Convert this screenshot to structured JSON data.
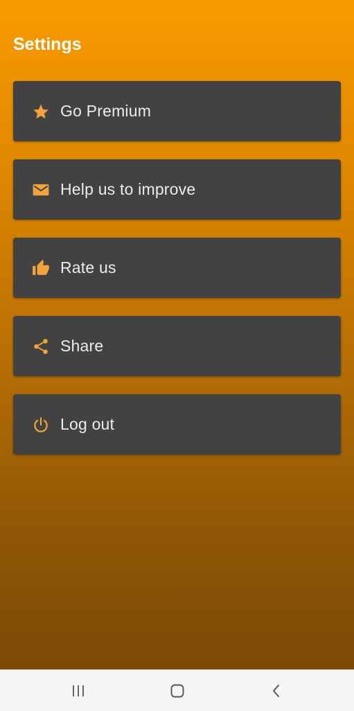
{
  "header": {
    "title": "Settings"
  },
  "colors": {
    "gradient_top": "#FA9A00",
    "gradient_bottom": "#7A4A06",
    "card": "#424242",
    "icon_accent": "#F2A33A",
    "text": "#ECECEC",
    "navbar": "#F5F5F5"
  },
  "menu": {
    "items": [
      {
        "label": "Go Premium",
        "icon": "star-icon"
      },
      {
        "label": "Help us to improve",
        "icon": "mail-icon"
      },
      {
        "label": "Rate us",
        "icon": "thumbs-up-icon"
      },
      {
        "label": "Share",
        "icon": "share-icon"
      },
      {
        "label": "Log out",
        "icon": "power-icon"
      }
    ]
  },
  "navbar": {
    "buttons": [
      "recent-apps-icon",
      "home-icon",
      "back-icon"
    ]
  }
}
